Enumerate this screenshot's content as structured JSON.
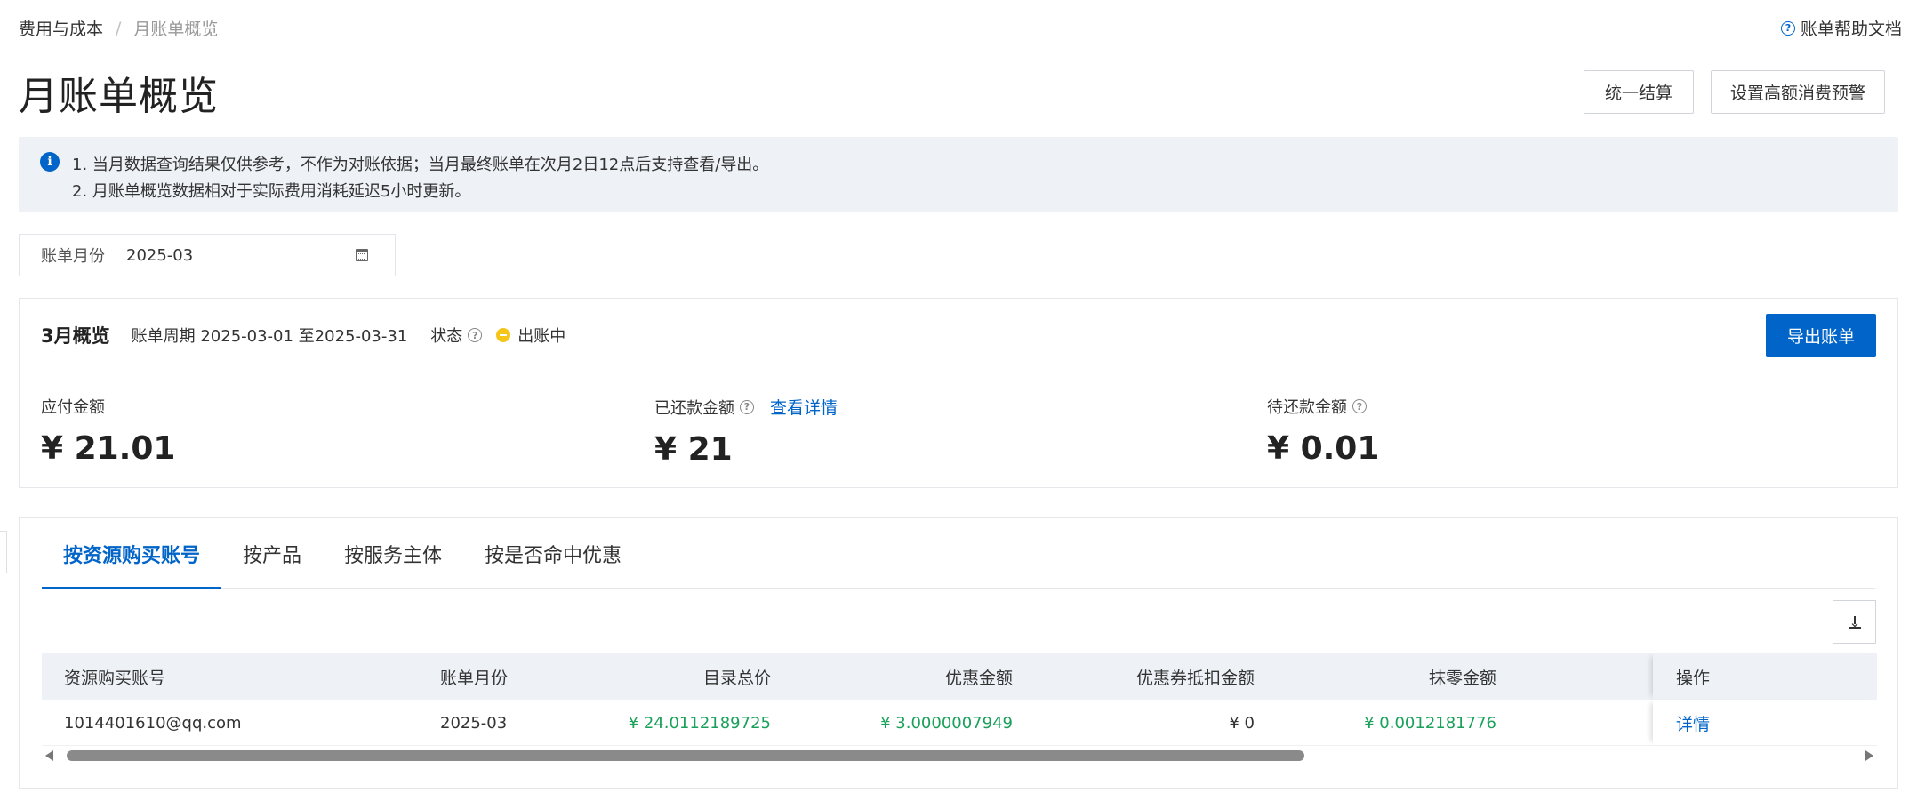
{
  "breadcrumb": {
    "parent": "费用与成本",
    "separator": "/",
    "current": "月账单概览"
  },
  "help": {
    "label": "账单帮助文档"
  },
  "page": {
    "title": "月账单概览"
  },
  "actions": {
    "settle": "统一结算",
    "alert": "设置高额消费预警"
  },
  "notice": {
    "line1": "1. 当月数据查询结果仅供参考，不作为对账依据；当月最终账单在次月2日12点后支持查看/导出。",
    "line2": "2. 月账单概览数据相对于实际费用消耗延迟5小时更新。"
  },
  "filter": {
    "label": "账单月份",
    "value": "2025-03"
  },
  "overview": {
    "title": "3月概览",
    "period": "账单周期 2025-03-01 至2025-03-31",
    "status_label": "状态",
    "status_value": "出账中",
    "status_color": "#f5c518",
    "export_label": "导出账单",
    "metrics": [
      {
        "label": "应付金额",
        "value": "¥ 21.01"
      },
      {
        "label": "已还款金额",
        "link": "查看详情",
        "value": "¥ 21"
      },
      {
        "label": "待还款金额",
        "value": "¥ 0.01"
      }
    ]
  },
  "tabs": [
    {
      "label": "按资源购买账号",
      "active": true
    },
    {
      "label": "按产品"
    },
    {
      "label": "按服务主体"
    },
    {
      "label": "按是否命中优惠"
    }
  ],
  "table": {
    "headers": {
      "account": "资源购买账号",
      "month": "账单月份",
      "list_price": "目录总价",
      "discount": "优惠金额",
      "coupon": "优惠券抵扣金额",
      "rounding": "抹零金额",
      "operation": "操作"
    },
    "rows": [
      {
        "account": "1014401610@qq.com",
        "month": "2025-03",
        "list_price": "¥ 24.0112189725",
        "discount": "¥ 3.0000007949",
        "coupon": "¥ 0",
        "rounding": "¥ 0.0012181776",
        "operation": "详情"
      }
    ]
  },
  "colors": {
    "primary": "#0064c8",
    "positive": "#19a05a",
    "notice_bg": "#eef2f7"
  }
}
